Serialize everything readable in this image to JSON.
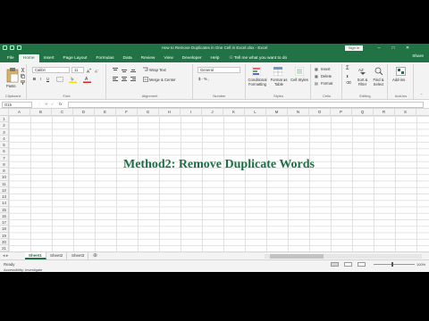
{
  "window": {
    "title": "How to Remove Duplicates in One Cell in Excel.xlsx  -  Excel",
    "sign_in": "Sign in",
    "minimize": "–",
    "maximize": "□",
    "close": "✕"
  },
  "tabs": [
    "File",
    "Home",
    "Insert",
    "Page Layout",
    "Formulas",
    "Data",
    "Review",
    "View",
    "Developer",
    "Help"
  ],
  "tell_me": "Tell me what you want to do",
  "share": "Share",
  "ribbon": {
    "clipboard": {
      "paste": "Paste",
      "label": "Clipboard"
    },
    "font": {
      "name": "Calibri",
      "size": "11",
      "bold": "B",
      "italic": "I",
      "underline": "U",
      "label": "Font"
    },
    "alignment": {
      "wrap": "Wrap Text",
      "merge": "Merge & Center",
      "label": "Alignment"
    },
    "number": {
      "format": "General",
      "currency": "$ - % ,",
      "label": "Number"
    },
    "styles": {
      "conditional": "Conditional Formatting",
      "format_table": "Format as Table",
      "cell_styles": "Cell Styles",
      "label": "Styles"
    },
    "cells": {
      "insert": "Insert",
      "delete": "Delete",
      "format": "Format",
      "label": "Cells"
    },
    "editing": {
      "sum": "Σ",
      "sort": "Sort & Filter",
      "find": "Find & Select",
      "label": "Editing"
    },
    "addins": {
      "add_ins": "Add-ins",
      "label": "Add-ins"
    }
  },
  "formula_bar": {
    "name_box": "O15",
    "fx": "fx",
    "value": ""
  },
  "columns": [
    "A",
    "B",
    "C",
    "D",
    "E",
    "F",
    "G",
    "H",
    "I",
    "J",
    "K",
    "L",
    "M",
    "N",
    "O",
    "P",
    "Q",
    "R",
    "S"
  ],
  "rows": [
    "1",
    "2",
    "3",
    "4",
    "5",
    "6",
    "7",
    "8",
    "9",
    "10",
    "11",
    "12",
    "13",
    "14",
    "15",
    "16",
    "17",
    "18",
    "19",
    "20",
    "21"
  ],
  "sheet_heading": "Method2: Remove Duplicate Words",
  "sheets": [
    "Sheet1",
    "Sheet2",
    "Sheet3"
  ],
  "active_sheet": "Sheet1",
  "status": {
    "ready": "Ready",
    "accessibility": "Accessibility: Investigate",
    "zoom": "100%"
  },
  "colors": {
    "accent": "#217346",
    "heading": "#1e6e46"
  }
}
